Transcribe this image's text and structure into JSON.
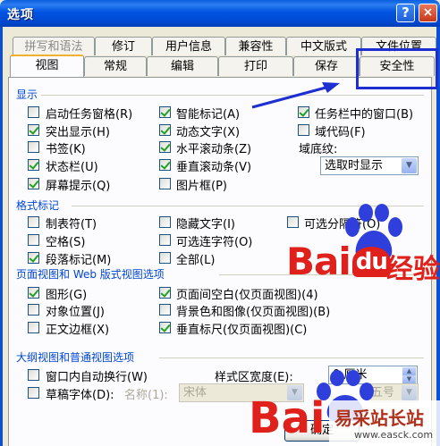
{
  "window": {
    "title": "选项",
    "help_glyph": "?",
    "close_glyph": "×"
  },
  "tabs_row1": [
    {
      "label": "拼写和语法",
      "disabled": true
    },
    {
      "label": "修订"
    },
    {
      "label": "用户信息"
    },
    {
      "label": "兼容性"
    },
    {
      "label": "中文版式"
    },
    {
      "label": "文件位置"
    }
  ],
  "tabs_row2": [
    {
      "label": "视图",
      "active": true
    },
    {
      "label": "常规"
    },
    {
      "label": "编辑"
    },
    {
      "label": "打印"
    },
    {
      "label": "保存"
    },
    {
      "label": "安全性"
    }
  ],
  "display": {
    "title": "显示",
    "items": [
      {
        "label": "启动任务窗格(R)",
        "checked": false
      },
      {
        "label": "突出显示(H)",
        "checked": true
      },
      {
        "label": "书签(K)",
        "checked": false
      },
      {
        "label": "状态栏(U)",
        "checked": true
      },
      {
        "label": "屏幕提示(Q)",
        "checked": true
      },
      {
        "label": "智能标记(A)",
        "checked": true
      },
      {
        "label": "动态文字(X)",
        "checked": true
      },
      {
        "label": "水平滚动条(Z)",
        "checked": true
      },
      {
        "label": "垂直滚动条(V)",
        "checked": true
      },
      {
        "label": "图片框(P)",
        "checked": false
      },
      {
        "label": "任务栏中的窗口(B)",
        "checked": true
      },
      {
        "label": "域代码(F)",
        "checked": false
      }
    ],
    "field_shading_label": "域底纹:",
    "field_shading_value": "选取时显示"
  },
  "format_marks": {
    "title": "格式标记",
    "items": [
      {
        "label": "制表符(T)",
        "checked": false
      },
      {
        "label": "空格(S)",
        "checked": false
      },
      {
        "label": "段落标记(M)",
        "checked": true
      },
      {
        "label": "隐藏文字(I)",
        "checked": false
      },
      {
        "label": "可选连字符(O)",
        "checked": false
      },
      {
        "label": "全部(L)",
        "checked": false
      },
      {
        "label": "可选分隔符(O)",
        "checked": false
      }
    ]
  },
  "page_view": {
    "title": "页面视图和 Web 版式视图选项",
    "items": [
      {
        "label": "图形(G)",
        "checked": true
      },
      {
        "label": "对象位置(J)",
        "checked": false
      },
      {
        "label": "正文边框(X)",
        "checked": false
      },
      {
        "label": "页面间空白(仅页面视图)(4)",
        "checked": true
      },
      {
        "label": "背景色和图像(仅页面视图)(B)",
        "checked": false
      },
      {
        "label": "垂直标尺(仅页面视图)(C)",
        "checked": true
      }
    ]
  },
  "outline": {
    "title": "大纲视图和普通视图选项",
    "wrap_label": "窗口内自动换行(W)",
    "wrap_checked": false,
    "draft_font_label": "草稿字体(D):",
    "draft_font_checked": false,
    "name_label": "名称(1):",
    "name_value": "宋体",
    "style_width_label": "样式区宽度(E):",
    "style_width_value": "0 厘米",
    "size_value": "五号"
  },
  "buttons": {
    "ok_label": "确定"
  },
  "watermarks": {
    "baidu_text": "Bai",
    "baidu_du": "du",
    "jingyan": "经验",
    "site_name": "易采站长站",
    "site_url": "www.easck.com"
  },
  "colors": {
    "title_bar": "#0054e3",
    "section_title": "#0046d5",
    "annotation_box": "#1d2fd0",
    "baidu_red": "#e0201a",
    "baidu_blue": "#2e3fdc"
  }
}
